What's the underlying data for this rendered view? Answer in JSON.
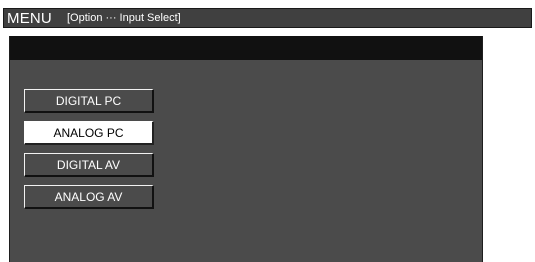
{
  "menu_bar": {
    "title": "MENU",
    "path": "[Option ··· Input Select]"
  },
  "input_select": {
    "selected_index": 1,
    "options": [
      {
        "label": "DIGITAL PC"
      },
      {
        "label": "ANALOG PC"
      },
      {
        "label": "DIGITAL AV"
      },
      {
        "label": "ANALOG AV"
      }
    ]
  },
  "colors": {
    "bar_background": "#404040",
    "panel_background": "#4b4b4b",
    "panel_header": "#111111",
    "selected_option": "#ffffff",
    "text": "#ffffff"
  }
}
